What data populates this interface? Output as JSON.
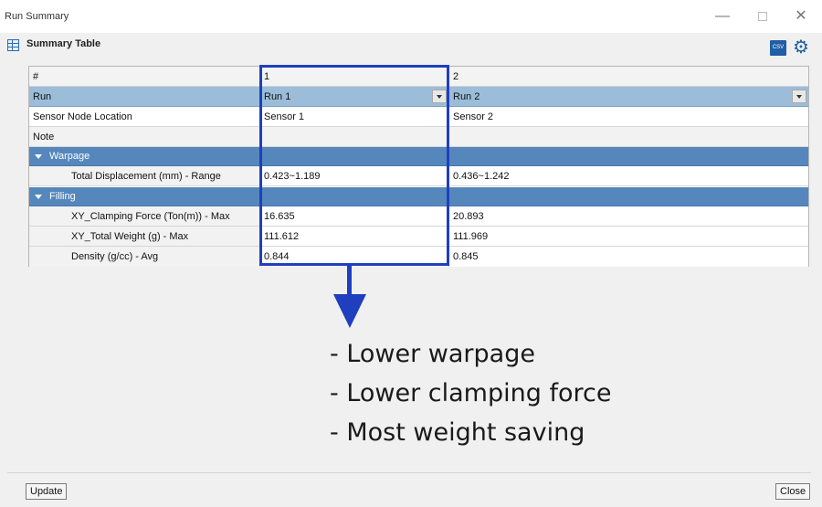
{
  "window": {
    "title": "Run Summary",
    "minimize_glyph": "—",
    "close_glyph": "✕"
  },
  "header": {
    "title": "Summary Table",
    "icons": [
      "table-icon",
      "csv-icon",
      "gear-icon"
    ],
    "csv_label": "CSV"
  },
  "table": {
    "header": {
      "label": "#",
      "col1": "1",
      "col2": "2"
    },
    "run_row": {
      "label": "Run",
      "col1": "Run 1",
      "col2": "Run 2"
    },
    "sensor_row": {
      "label": "Sensor Node Location",
      "col1": "Sensor 1",
      "col2": "Sensor 2"
    },
    "note_row": {
      "label": "Note",
      "col1": "",
      "col2": ""
    },
    "groups": [
      {
        "label": "Warpage",
        "rows": [
          {
            "label": "Total Displacement (mm) - Range",
            "col1": "0.423~1.189",
            "col2": "0.436~1.242"
          }
        ]
      },
      {
        "label": "Filling",
        "rows": [
          {
            "label": "XY_Clamping Force (Ton(m)) - Max",
            "col1": "16.635",
            "col2": "20.893"
          },
          {
            "label": "XY_Total Weight (g) - Max",
            "col1": "111.612",
            "col2": "111.969"
          },
          {
            "label": "Density (g/cc) - Avg",
            "col1": "0.844",
            "col2": "0.845"
          }
        ]
      }
    ]
  },
  "annotation": {
    "highlight_color": "#1f3fbf",
    "bullets": [
      "- Lower warpage",
      "- Lower clamping force",
      "- Most weight saving"
    ]
  },
  "footer": {
    "update_label": "Update",
    "close_label": "Close"
  },
  "colors": {
    "run_row": "#9bbdd9",
    "group_row": "#5587bd",
    "accent": "#1f5fa6"
  }
}
